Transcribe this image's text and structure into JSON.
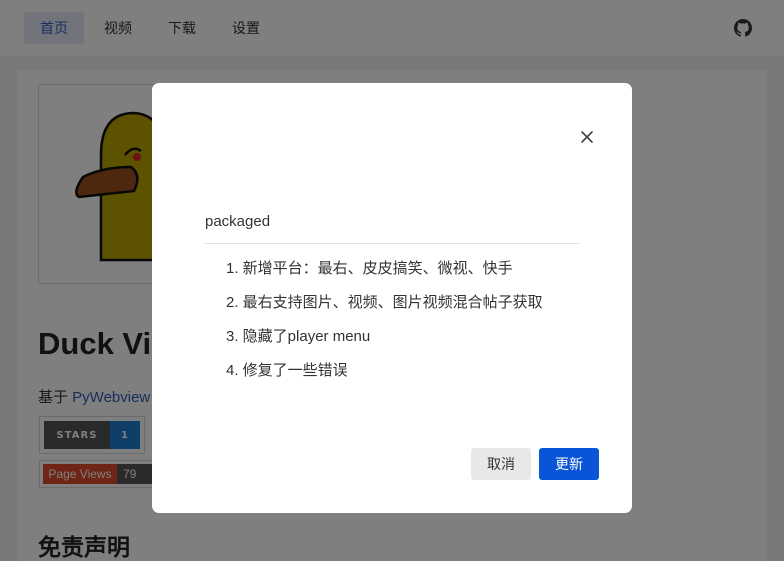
{
  "nav": {
    "items": [
      {
        "label": "首页",
        "active": true
      },
      {
        "label": "视频",
        "active": false
      },
      {
        "label": "下载",
        "active": false
      },
      {
        "label": "设置",
        "active": false
      }
    ],
    "github_icon": "github-icon"
  },
  "page": {
    "title": "Duck Vi",
    "based_on_prefix": "基于 ",
    "based_on_link": "PyWebview",
    "badges": {
      "stars_label": "STARS",
      "stars_value": "1",
      "views_label": "Page Views",
      "views_value": "79"
    },
    "disclaimer_heading": "免责声明"
  },
  "modal": {
    "title": "packaged",
    "changelog": [
      "1. 新增平台：最右、皮皮搞笑、微视、快手",
      "2. 最右支持图片、视频、图片视频混合帖子获取",
      "3. 隐藏了player menu",
      "4. 修复了一些错误"
    ],
    "cancel_label": "取消",
    "update_label": "更新",
    "close_icon": "close-icon"
  },
  "colors": {
    "accent": "#0a54d8",
    "nav_active_bg": "#e3eaf7",
    "overlay": "rgba(0,0,0,0.5)"
  }
}
